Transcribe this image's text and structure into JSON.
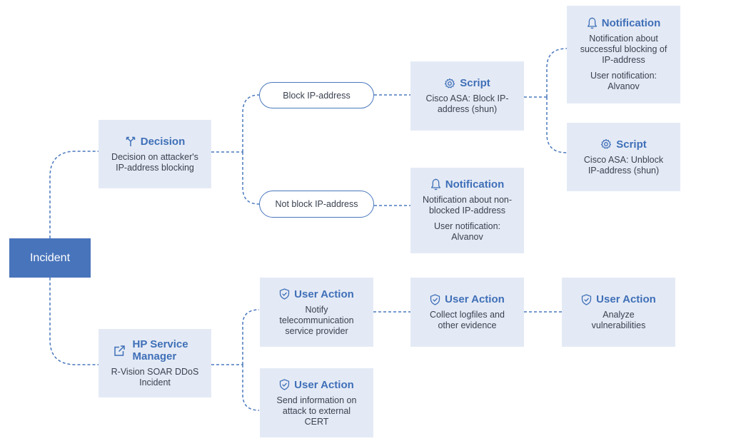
{
  "colors": {
    "accent": "#4874bb",
    "connector": "#4a78bd",
    "node_fill": "#e4eaf5",
    "title_text": "#3f6fb8",
    "body_text": "#3a4150"
  },
  "root": {
    "label": "Incident"
  },
  "nodes": {
    "decision": {
      "icon": "branch-split-icon",
      "title": "Decision",
      "desc": "Decision on attacker's IP-address blocking"
    },
    "block_branch": {
      "label": "Block IP-address"
    },
    "not_block_branch": {
      "label": "Not block IP-address"
    },
    "script_block": {
      "icon": "gear-icon",
      "title": "Script",
      "desc": "Cisco ASA: Block IP-address (shun)"
    },
    "notification_success": {
      "icon": "bell-icon",
      "title": "Notification",
      "desc": "Notification about successful blocking of IP-address",
      "desc2": "User notification: Alvanov"
    },
    "script_unblock": {
      "icon": "gear-icon",
      "title": "Script",
      "desc": "Cisco ASA: Unblock IP-address (shun)"
    },
    "notification_nonblocked": {
      "icon": "bell-icon",
      "title": "Notification",
      "desc": "Notification about non-blocked IP-address",
      "desc2": "User notification: Alvanov"
    },
    "hp_service_manager": {
      "icon": "external-link-icon",
      "title": "HP Service Manager",
      "desc": "R-Vision SOAR DDoS Incident"
    },
    "action_notify_provider": {
      "icon": "shield-check-icon",
      "title": "User Action",
      "desc": "Notify telecommunication service provider"
    },
    "action_collect_logs": {
      "icon": "shield-check-icon",
      "title": "User Action",
      "desc": "Collect logfiles and other evidence"
    },
    "action_analyze": {
      "icon": "shield-check-icon",
      "title": "User Action",
      "desc": "Analyze vulnerabilities"
    },
    "action_send_cert": {
      "icon": "shield-check-icon",
      "title": "User Action",
      "desc": "Send information on attack to external CERT"
    }
  },
  "edges": [
    [
      "Incident",
      "Decision"
    ],
    [
      "Incident",
      "HP Service Manager"
    ],
    [
      "Decision",
      "Block IP-address"
    ],
    [
      "Decision",
      "Not block IP-address"
    ],
    [
      "Block IP-address",
      "Script: Block IP-address"
    ],
    [
      "Script: Block IP-address",
      "Notification: successful blocking"
    ],
    [
      "Script: Block IP-address",
      "Script: Unblock IP-address"
    ],
    [
      "Not block IP-address",
      "Notification: non-blocked"
    ],
    [
      "HP Service Manager",
      "User Action: Notify provider"
    ],
    [
      "HP Service Manager",
      "User Action: Send to CERT"
    ],
    [
      "User Action: Notify provider",
      "User Action: Collect logfiles"
    ],
    [
      "User Action: Collect logfiles",
      "User Action: Analyze vulnerabilities"
    ]
  ]
}
